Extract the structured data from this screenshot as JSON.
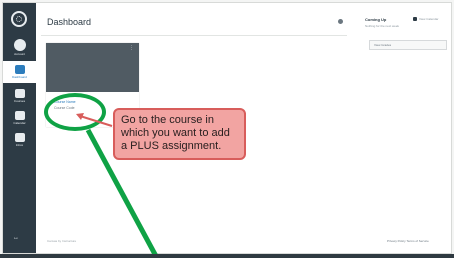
{
  "header": {
    "title": "Dashboard"
  },
  "sidebar": {
    "items": [
      {
        "label": "Account",
        "icon": "user-avatar-icon"
      },
      {
        "label": "Dashboard",
        "icon": "dashboard-icon",
        "active": true
      },
      {
        "label": "Courses",
        "icon": "book-icon"
      },
      {
        "label": "Calendar",
        "icon": "calendar-icon"
      },
      {
        "label": "Inbox",
        "icon": "inbox-icon"
      }
    ]
  },
  "todo": {
    "title": "Coming Up",
    "subtitle": "Nothing for the next week",
    "view_calendar": "View Calendar"
  },
  "view_grades_label": "View Grades",
  "course_card": {
    "name": "Course Name",
    "code": "Course Code"
  },
  "footer": {
    "left": "Canvas by Instructure",
    "right": "Privacy Policy  Terms of Service"
  },
  "callout": {
    "text": "Go to the course in which you want to add a PLUS assignment."
  },
  "colors": {
    "nav_bg": "#2d3b45",
    "accent": "#2d7dbd",
    "callout_bg": "#f2a4a2",
    "callout_border": "#d85d5b",
    "highlight": "#0fa245"
  }
}
